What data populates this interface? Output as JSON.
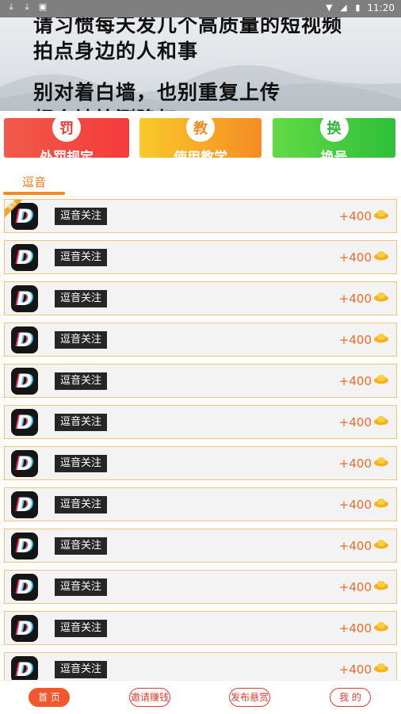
{
  "status_bar": {
    "time": "11:20",
    "left_icons": [
      "download-icon",
      "download-icon",
      "image-icon"
    ],
    "right_icons": [
      "wifi-icon",
      "signal-icon",
      "battery-icon"
    ]
  },
  "banner": {
    "lines": [
      "请习惯每天发几个高质量的短视频",
      "拍点身边的人和事",
      "别对着白墙，也别重复上传",
      "都会被检测降权"
    ]
  },
  "quick_links": [
    {
      "icon_char": "罚",
      "label": "处罚规定",
      "color": "#f04545"
    },
    {
      "icon_char": "教",
      "label": "使用教学",
      "color": "#f5a024"
    },
    {
      "icon_char": "换",
      "label": "换号",
      "color": "#3fc83e"
    }
  ],
  "tabs": [
    {
      "label": "逗音",
      "active": true
    }
  ],
  "tasks": {
    "ribbon_text": "推荐",
    "items": [
      {
        "title": "逗音关注",
        "reward": "+400",
        "app_icon": "douyin-icon"
      },
      {
        "title": "逗音关注",
        "reward": "+400",
        "app_icon": "douyin-icon"
      },
      {
        "title": "逗音关注",
        "reward": "+400",
        "app_icon": "douyin-icon"
      },
      {
        "title": "逗音关注",
        "reward": "+400",
        "app_icon": "douyin-icon"
      },
      {
        "title": "逗音关注",
        "reward": "+400",
        "app_icon": "douyin-icon"
      },
      {
        "title": "逗音关注",
        "reward": "+400",
        "app_icon": "douyin-icon"
      },
      {
        "title": "逗音关注",
        "reward": "+400",
        "app_icon": "douyin-icon"
      },
      {
        "title": "逗音关注",
        "reward": "+400",
        "app_icon": "douyin-icon"
      },
      {
        "title": "逗音关注",
        "reward": "+400",
        "app_icon": "douyin-icon"
      },
      {
        "title": "逗音关注",
        "reward": "+400",
        "app_icon": "douyin-icon"
      },
      {
        "title": "逗音关注",
        "reward": "+400",
        "app_icon": "douyin-icon"
      },
      {
        "title": "逗音关注",
        "reward": "+400",
        "app_icon": "douyin-icon"
      }
    ]
  },
  "bottom_nav": [
    {
      "label": "首 页",
      "active": true
    },
    {
      "label": "邀请赚钱",
      "active": false
    },
    {
      "label": "发布悬赏",
      "active": false
    },
    {
      "label": "我 的",
      "active": false
    }
  ],
  "colors": {
    "accent": "#f28a1e",
    "reward": "#f26a2a",
    "nav_active": "#f3572c"
  }
}
